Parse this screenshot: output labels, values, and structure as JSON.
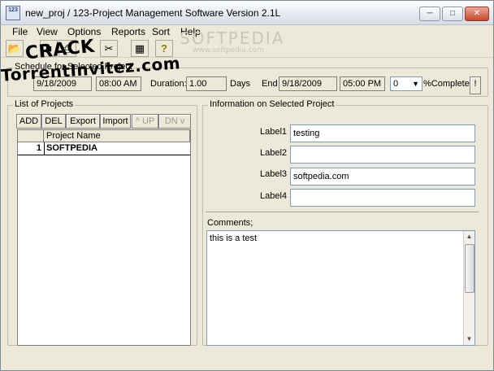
{
  "window": {
    "title": "new_proj  /  123-Project Management Software Version 2.1L",
    "app_icon_text": "123"
  },
  "menu": [
    "File",
    "View",
    "Options",
    "Reports",
    "Sort",
    "Help"
  ],
  "watermark": {
    "brand": "SOFTPEDIA",
    "url": "www.softpedia.com"
  },
  "overlay": {
    "line1": "CRACK",
    "line2": "TorrentInvitez.com"
  },
  "schedule": {
    "legend": "Schedule for Selected Project",
    "start_date": "9/18/2009",
    "start_time": "08:00 AM",
    "duration_label": "Duration:",
    "duration_value": "1.00",
    "days_label": "Days",
    "end_label": "End",
    "end_date": "9/18/2009",
    "end_time": "05:00 PM",
    "complete_value": "0",
    "complete_label": "%Complete",
    "flag_button": "!"
  },
  "projects": {
    "legend": "List of Projects",
    "buttons": {
      "add": "ADD",
      "del": "DEL",
      "export": "Export",
      "import": "Import",
      "up": "^ UP",
      "dn": "DN v"
    },
    "column_header": "Project Name",
    "rows": [
      {
        "num": "1",
        "name": "SOFTPEDIA"
      }
    ]
  },
  "info": {
    "legend": "Information on Selected Project",
    "label1": "Label1",
    "value1": "testing",
    "label2": "Label2",
    "value2": "",
    "label3": "Label3",
    "value3": "softpedia.com",
    "label4": "Label4",
    "value4": "",
    "comments_label": "Comments;",
    "comments_value": "this is a test"
  }
}
